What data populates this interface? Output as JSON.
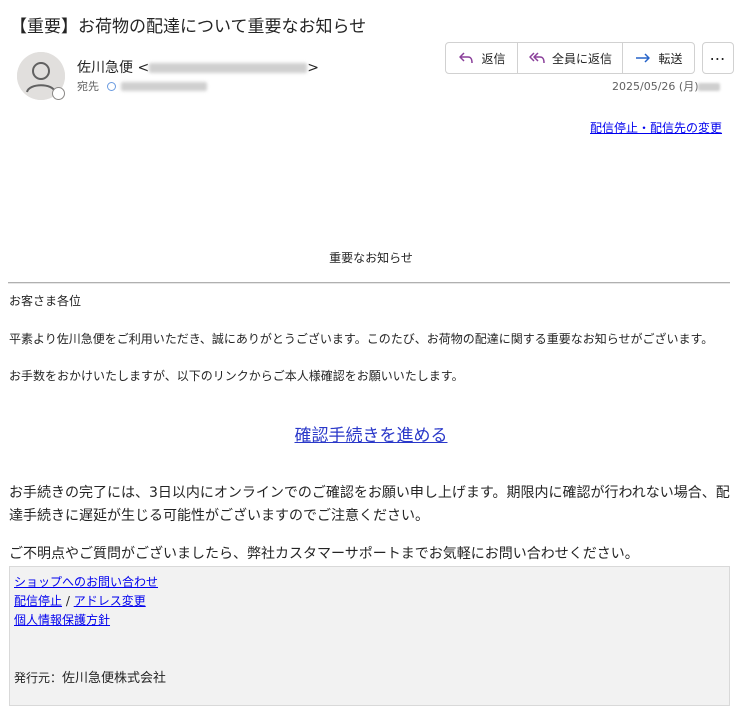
{
  "email": {
    "subject": "【重要】お荷物の配達について重要なお知らせ",
    "sender_name": "佐川急便",
    "sender_addr_open": "<",
    "sender_addr_close": ">",
    "to_label": "宛先",
    "date": "2025/05/26 (月)"
  },
  "toolbar": {
    "reply_label": "返信",
    "reply_all_label": "全員に返信",
    "forward_label": "転送",
    "more_label": "⋯"
  },
  "body": {
    "unsubscribe_top": "配信停止・配信先の変更",
    "notice_heading": "重要なお知らせ",
    "greeting": "お客さま各位",
    "para1": "平素より佐川急便をご利用いただき、誠にありがとうございます。このたび、お荷物の配達に関する重要なお知らせがございます。",
    "para2": "お手数をおかけいたしますが、以下のリンクからご本人様確認をお願いいたします。",
    "cta": "確認手続きを進める",
    "para3": "お手続きの完了には、3日以内にオンラインでのご確認をお願い申し上げます。期限内に確認が行われない場合、配達手続きに遅延が生じる可能性がございますのでご注意ください。",
    "para4": "ご不明点やご質問がございましたら、弊社カスタマーサポートまでお気軽にお問い合わせください。"
  },
  "footer": {
    "shop_contact": "ショップへのお問い合わせ",
    "unsubscribe": "配信停止",
    "separator": " / ",
    "address_change": "アドレス変更",
    "privacy": "個人情報保護方針",
    "publisher_label": "発行元：",
    "publisher_name": "佐川急便株式会社"
  },
  "colors": {
    "link": "#0000ee",
    "cta_link": "#2a38c9",
    "reply_icon": "#8a3f9a",
    "forward_icon": "#2563c9"
  },
  "icons": [
    "person-avatar-icon",
    "reply-icon",
    "reply-all-icon",
    "forward-icon",
    "more-icon"
  ]
}
